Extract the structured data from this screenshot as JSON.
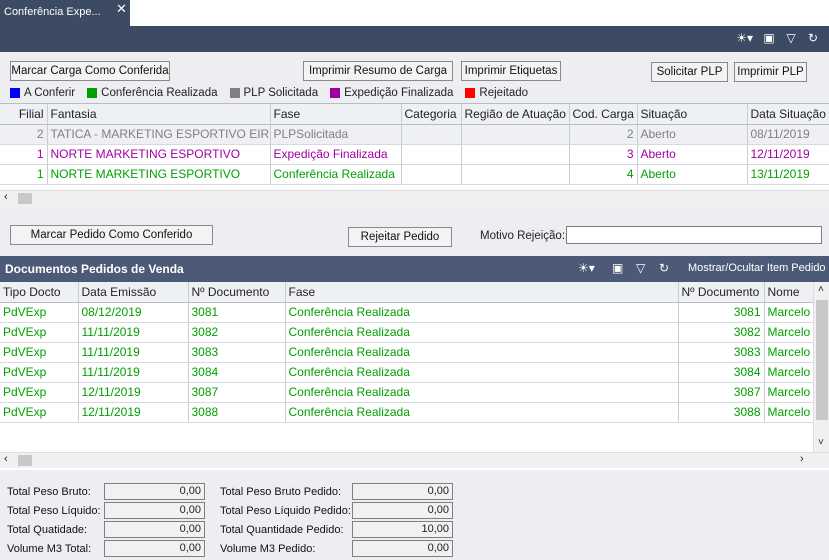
{
  "tab": {
    "title": "Conferência Expe...",
    "close": "✕"
  },
  "toolbar_icons": [
    "sun-menu-icon",
    "window-icon",
    "filter-icon",
    "refresh-icon"
  ],
  "top_buttons": {
    "mark_load": "Marcar Carga Como Conferida",
    "print_summary": "Imprimir Resumo de Carga",
    "print_labels": "Imprimir Etiquetas",
    "request_plp": "Solicitar PLP",
    "print_plp": "Imprimir PLP"
  },
  "legend": [
    {
      "label": "A Conferir",
      "color": "#0000ff"
    },
    {
      "label": "Conferência Realizada",
      "color": "#00a000"
    },
    {
      "label": "PLP Solicitada",
      "color": "#808080"
    },
    {
      "label": "Expedição Finalizada",
      "color": "#a000a0"
    },
    {
      "label": "Rejeitado",
      "color": "#ff0000"
    }
  ],
  "loads_table": {
    "columns": [
      "Filial",
      "Fantasia",
      "Fase",
      "Categoria",
      "Região de Atuação",
      "Cod. Carga",
      "Situação",
      "Data Situação"
    ],
    "rows": [
      {
        "color": "#808080",
        "cells": [
          "2",
          "TATICA - MARKETING ESPORTIVO EIRE",
          "PLPSolicitada",
          "",
          "",
          "2",
          "Aberto",
          "08/11/2019"
        ]
      },
      {
        "color": "#a000a0",
        "cells": [
          "1",
          "NORTE MARKETING ESPORTIVO",
          "Expedição Finalizada",
          "",
          "",
          "3",
          "Aberto",
          "12/11/2019"
        ]
      },
      {
        "color": "#00a000",
        "cells": [
          "1",
          "NORTE MARKETING ESPORTIVO",
          "Conferência Realizada",
          "",
          "",
          "4",
          "Aberto",
          "13/11/2019"
        ]
      }
    ]
  },
  "mid_buttons": {
    "mark_order": "Marcar Pedido Como Conferido",
    "reject_order": "Rejeitar Pedido",
    "reject_reason_label": "Motivo Rejeição:",
    "reject_reason_value": ""
  },
  "docs_panel": {
    "title": "Documentos Pedidos de Venda",
    "toggle_label": "Mostrar/Ocultar Item Pedido",
    "columns": [
      "Tipo Docto",
      "Data Emissão",
      "Nº Documento",
      "Fase",
      "Nº Documento",
      "Nome"
    ],
    "rows": [
      [
        "PdVExp",
        "08/12/2019",
        "3081",
        "Conferência Realizada",
        "3081",
        "Marcelo"
      ],
      [
        "PdVExp",
        "11/11/2019",
        "3082",
        "Conferência Realizada",
        "3082",
        "Marcelo"
      ],
      [
        "PdVExp",
        "11/11/2019",
        "3083",
        "Conferência Realizada",
        "3083",
        "Marcelo"
      ],
      [
        "PdVExp",
        "11/11/2019",
        "3084",
        "Conferência Realizada",
        "3084",
        "Marcelo"
      ],
      [
        "PdVExp",
        "12/11/2019",
        "3087",
        "Conferência Realizada",
        "3087",
        "Marcelo"
      ],
      [
        "PdVExp",
        "12/11/2019",
        "3088",
        "Conferência Realizada",
        "3088",
        "Marcelo"
      ]
    ],
    "row_color": "#00a000"
  },
  "totals": {
    "left": [
      {
        "label": "Total Peso Bruto:",
        "value": "0,00"
      },
      {
        "label": "Total Peso Líquido:",
        "value": "0,00"
      },
      {
        "label": "Total Quatidade:",
        "value": "0,00"
      },
      {
        "label": "Volume M3 Total:",
        "value": "0,00"
      }
    ],
    "right": [
      {
        "label": "Total Peso Bruto Pedido:",
        "value": "0,00"
      },
      {
        "label": "Total Peso Líquido Pedido:",
        "value": "0,00"
      },
      {
        "label": "Total Quantidade Pedido:",
        "value": "10,00"
      },
      {
        "label": "Volume M3 Pedido:",
        "value": "0,00"
      }
    ]
  }
}
